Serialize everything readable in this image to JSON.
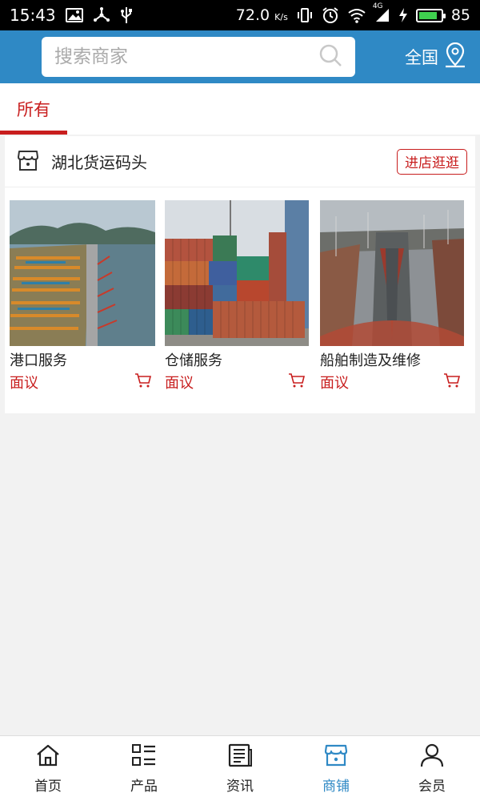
{
  "status_bar": {
    "time": "15:43",
    "network_speed": "72.0",
    "speed_unit": "K/s",
    "network_type": "4G",
    "battery_level": "85"
  },
  "header": {
    "search_placeholder": "搜索商家",
    "region_label": "全国"
  },
  "tabs": [
    {
      "label": "所有",
      "active": true
    }
  ],
  "store": {
    "name": "湖北货运码头",
    "visit_button": "进店逛逛",
    "products": [
      {
        "name": "港口服务",
        "price": "面议"
      },
      {
        "name": "仓储服务",
        "price": "面议"
      },
      {
        "name": "船舶制造及维修",
        "price": "面议"
      }
    ]
  },
  "bottom_nav": [
    {
      "label": "首页",
      "icon": "home-icon",
      "active": false
    },
    {
      "label": "产品",
      "icon": "product-list-icon",
      "active": false
    },
    {
      "label": "资讯",
      "icon": "news-icon",
      "active": false
    },
    {
      "label": "商铺",
      "icon": "shop-icon",
      "active": true
    },
    {
      "label": "会员",
      "icon": "user-icon",
      "active": false
    }
  ],
  "colors": {
    "header_blue": "#2f89c5",
    "accent_red": "#c81e1e",
    "battery_green": "#3fd04f"
  }
}
